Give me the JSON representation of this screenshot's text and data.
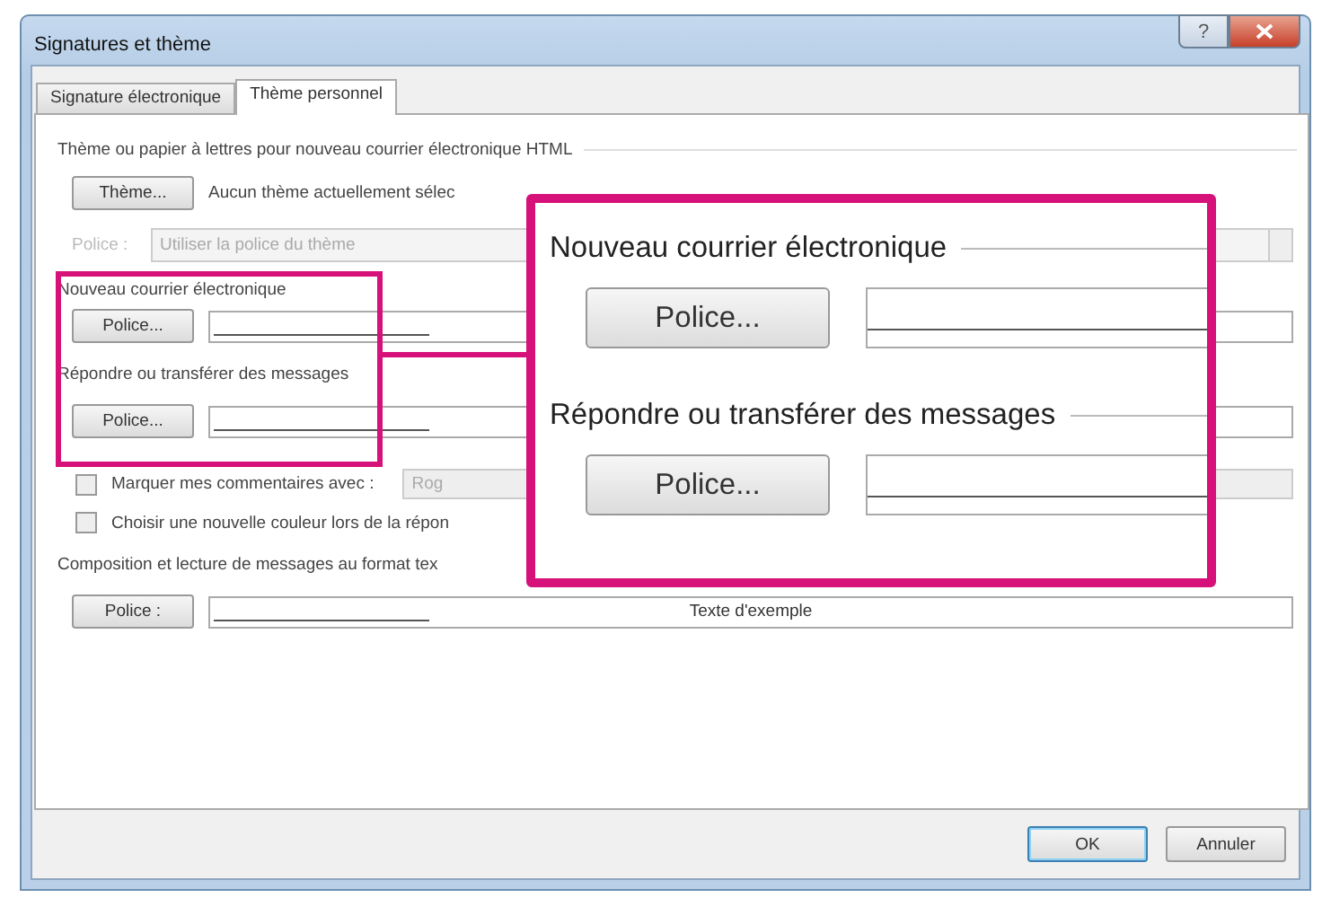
{
  "window": {
    "title": "Signatures et thème",
    "help_glyph": "?"
  },
  "tabs": [
    {
      "label": "Signature électronique",
      "selected": false
    },
    {
      "label": "Thème personnel",
      "selected": true
    }
  ],
  "stationery": {
    "heading": "Thème ou papier à lettres pour nouveau courrier électronique HTML",
    "theme_button": "Thème...",
    "theme_status": "Aucun thème actuellement sélec",
    "font_label": "Police :",
    "font_value": "Utiliser la police du thème",
    "font_disabled": true
  },
  "new_mail": {
    "heading": "Nouveau courrier électronique",
    "button": "Police..."
  },
  "reply": {
    "heading": "Répondre ou transférer des messages",
    "button": "Police..."
  },
  "options": [
    {
      "label": "Marquer mes commentaires avec :",
      "checked": false,
      "value": "Rog"
    },
    {
      "label": "Choisir une nouvelle couleur lors de la répon",
      "checked": false
    }
  ],
  "plain_text": {
    "heading": "Composition et lecture de messages au format tex",
    "button": "Police :",
    "sample": "Texte d'exemple"
  },
  "callout": {
    "sections": [
      {
        "heading": "Nouveau courrier électronique",
        "button": "Police..."
      },
      {
        "heading": "Répondre ou transférer des messages",
        "button": "Police..."
      }
    ]
  },
  "buttons": [
    {
      "label": "OK",
      "default": true
    },
    {
      "label": "Annuler",
      "default": false
    }
  ]
}
